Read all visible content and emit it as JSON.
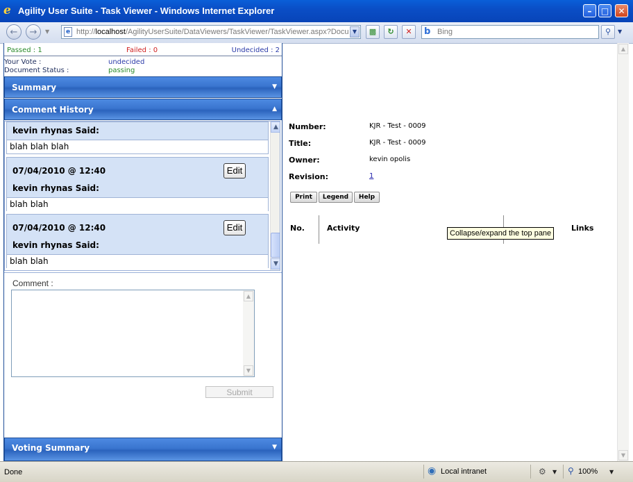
{
  "window": {
    "title": "Agility User Suite - Task Viewer - Windows Internet Explorer"
  },
  "address_bar": {
    "url_prefix": "http://",
    "url_host": "localhost",
    "url_rest": "/AgilityUserSuite/DataViewers/TaskViewer/TaskViewer.aspx?Docu",
    "search_placeholder": "Bing"
  },
  "stats": {
    "passed": "Passed : 1",
    "failed": "Failed : 0",
    "undecided": "Undecided : 2"
  },
  "vote": {
    "your_vote_label": "Your Vote :",
    "your_vote_value": "undecided",
    "doc_status_label": "Document Status :",
    "doc_status_value": "passing"
  },
  "sections": {
    "summary": "Summary",
    "comment_history": "Comment History",
    "voting_summary": "Voting Summary"
  },
  "comments": [
    {
      "author": "kevin rhynas Said:",
      "body": "blah blah blah"
    },
    {
      "date": "07/04/2010 @ 12:40",
      "edit_label": "Edit",
      "author": "kevin rhynas Said:",
      "body": "blah blah"
    },
    {
      "date": "07/04/2010 @ 12:40",
      "edit_label": "Edit",
      "author": "kevin rhynas Said:",
      "body": "blah blah"
    }
  ],
  "comment_form": {
    "label": "Comment :",
    "submit_label": "Submit"
  },
  "task": {
    "number_label": "Number:",
    "number_value": "KJR - Test - 0009",
    "title_label": "Title:",
    "title_value": "KJR - Test - 0009",
    "owner_label": "Owner:",
    "owner_value": "kevin opolis",
    "revision_label": "Revision:",
    "revision_value": "1"
  },
  "toolbar": {
    "print": "Print",
    "legend": "Legend",
    "help": "Help"
  },
  "table": {
    "col_no": "No.",
    "col_activity": "Activity",
    "col_links": "Links"
  },
  "tooltip": "Collapse/expand the top pane",
  "status_bar": {
    "status": "Done",
    "zone": "Local intranet",
    "zoom": "100%"
  }
}
